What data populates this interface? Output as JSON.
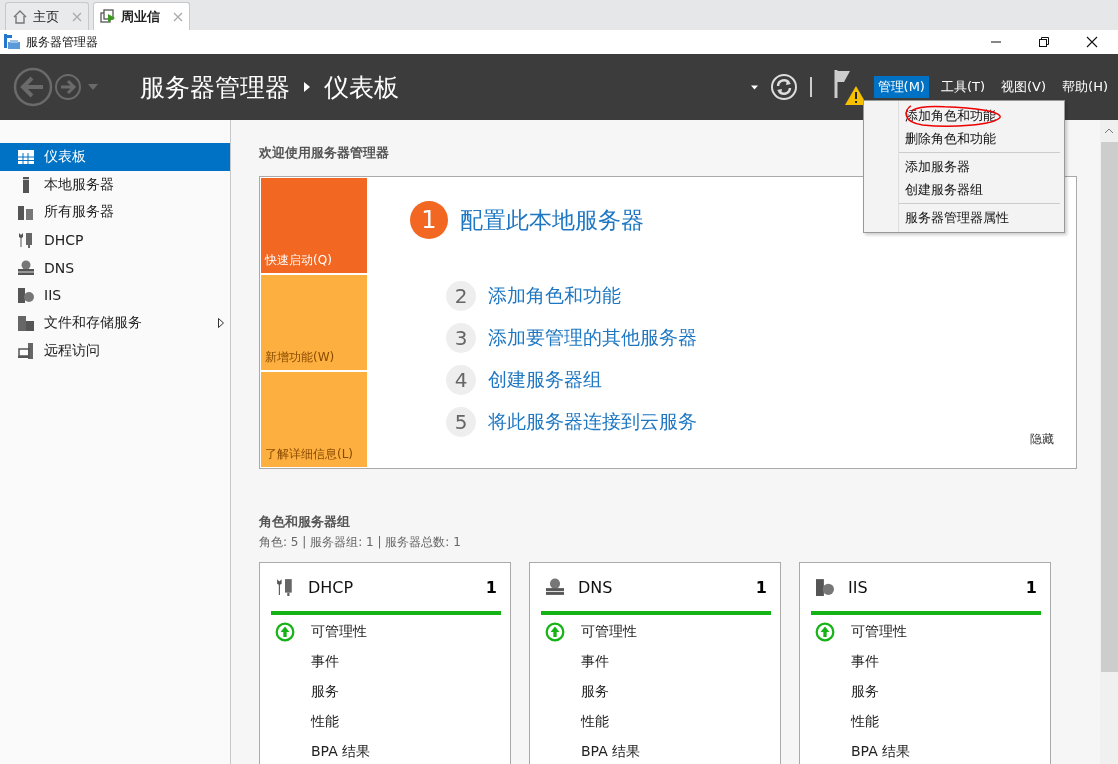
{
  "browser_tabs": [
    {
      "label": "主页",
      "kind": "home",
      "selected": false
    },
    {
      "label": "周业信",
      "kind": "remote",
      "selected": true
    }
  ],
  "window": {
    "title": "服务器管理器"
  },
  "header": {
    "breadcrumb": [
      "服务器管理器",
      "仪表板"
    ],
    "menus": [
      {
        "label": "管理(M)",
        "selected": true
      },
      {
        "label": "工具(T)",
        "selected": false
      },
      {
        "label": "视图(V)",
        "selected": false
      },
      {
        "label": "帮助(H)",
        "selected": false
      }
    ]
  },
  "dropdown": {
    "groups": [
      [
        "添加角色和功能",
        "删除角色和功能"
      ],
      [
        "添加服务器",
        "创建服务器组"
      ],
      [
        "服务器管理器属性"
      ]
    ]
  },
  "sidebar": {
    "items": [
      {
        "label": "仪表板",
        "kind": "dashboard",
        "selected": true,
        "has_submenu": false
      },
      {
        "label": "本地服务器",
        "kind": "server",
        "selected": false,
        "has_submenu": false
      },
      {
        "label": "所有服务器",
        "kind": "servers",
        "selected": false,
        "has_submenu": false
      },
      {
        "label": "DHCP",
        "kind": "dhcp",
        "selected": false,
        "has_submenu": false
      },
      {
        "label": "DNS",
        "kind": "dns",
        "selected": false,
        "has_submenu": false
      },
      {
        "label": "IIS",
        "kind": "iis",
        "selected": false,
        "has_submenu": false
      },
      {
        "label": "文件和存储服务",
        "kind": "files",
        "selected": false,
        "has_submenu": true
      },
      {
        "label": "远程访问",
        "kind": "remote",
        "selected": false,
        "has_submenu": false
      }
    ]
  },
  "welcome": {
    "title": "欢迎使用服务器管理器",
    "tiles": [
      {
        "label": "快速启动(Q)",
        "selected": true
      },
      {
        "label": "新增功能(W)",
        "selected": false
      },
      {
        "label": "了解详细信息(L)",
        "selected": false
      }
    ],
    "steps": [
      {
        "number": "1",
        "label": "配置此本地服务器",
        "kind": "primary"
      },
      {
        "number": "2",
        "label": "添加角色和功能",
        "kind": "secondary"
      },
      {
        "number": "3",
        "label": "添加要管理的其他服务器",
        "kind": "secondary"
      },
      {
        "number": "4",
        "label": "创建服务器组",
        "kind": "secondary"
      },
      {
        "number": "5",
        "label": "将此服务器连接到云服务",
        "kind": "secondary"
      }
    ],
    "hide": "隐藏"
  },
  "roles": {
    "title": "角色和服务器组",
    "summary": "角色: 5 | 服务器组: 1 | 服务器总数: 1",
    "cards": [
      {
        "name": "DHCP",
        "kind": "dhcp",
        "count": "1",
        "rows": [
          {
            "label": "可管理性",
            "kind": "status"
          },
          {
            "label": "事件",
            "kind": "plain"
          },
          {
            "label": "服务",
            "kind": "plain"
          },
          {
            "label": "性能",
            "kind": "plain"
          },
          {
            "label": "BPA 结果",
            "kind": "plain"
          }
        ]
      },
      {
        "name": "DNS",
        "kind": "dns",
        "count": "1",
        "rows": [
          {
            "label": "可管理性",
            "kind": "status"
          },
          {
            "label": "事件",
            "kind": "plain"
          },
          {
            "label": "服务",
            "kind": "plain"
          },
          {
            "label": "性能",
            "kind": "plain"
          },
          {
            "label": "BPA 结果",
            "kind": "plain"
          }
        ]
      },
      {
        "name": "IIS",
        "kind": "iis",
        "count": "1",
        "rows": [
          {
            "label": "可管理性",
            "kind": "status"
          },
          {
            "label": "事件",
            "kind": "plain"
          },
          {
            "label": "服务",
            "kind": "plain"
          },
          {
            "label": "性能",
            "kind": "plain"
          },
          {
            "label": "BPA 结果",
            "kind": "plain"
          }
        ]
      }
    ]
  }
}
